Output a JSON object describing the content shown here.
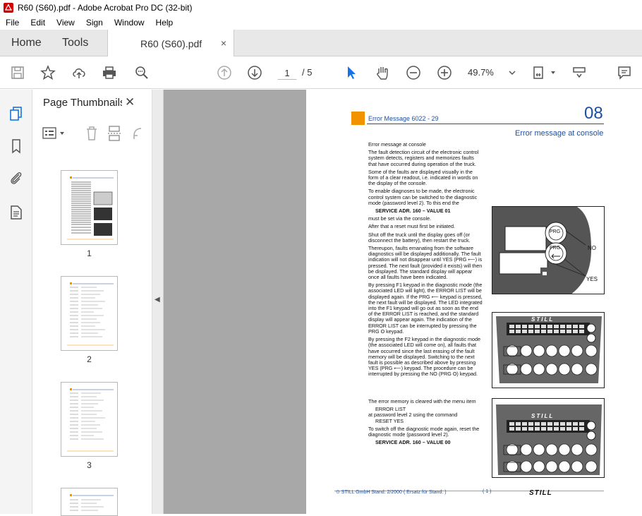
{
  "window": {
    "title": "R60 (S60).pdf - Adobe Acrobat Pro DC (32-bit)"
  },
  "menu": [
    "File",
    "Edit",
    "View",
    "Sign",
    "Window",
    "Help"
  ],
  "tabs": {
    "home": "Home",
    "tools": "Tools",
    "document": "R60 (S60).pdf",
    "close": "×"
  },
  "toolbar": {
    "page_current": "1",
    "page_sep": "/ 5",
    "zoom": "49.7%"
  },
  "panel": {
    "title": "Page Thumbnails",
    "close": "✕",
    "thumbnails": [
      "1",
      "2",
      "3"
    ]
  },
  "document": {
    "header_left": "Error Message  6022 - 29",
    "header_num": "08",
    "header_sub": "Error message at console",
    "p1_title": "Error message at console",
    "p1": "The fault detection circuit of the electronic control system detects, registers and memorizes faults that have occurred during operation of the truck.",
    "p2": "Some of the faults are displayed visually in the form of a clear readout, i.e. indicated in words on the display of the console.",
    "p3": "To enable diagnoses to be made, the electronic control system can be switched to the diagnostic mode (password level 2). To this end the",
    "p3_cmd": "SERVICE ADR. 160 – VALUE 01",
    "p4": "must be set via the console.",
    "p5": "After that a reset must first be initiated.",
    "p6": "Shut off the truck until the display goes off (or disconnect the battery), then restart the truck.",
    "p7": "Thereupon, faults emanating from the software diagnostics will be displayed additionally. The fault indication will not disappear until YES (PRG ⟵) is pressed. The next fault (provided it exists) will then be displayed. The standard display will appear once all faults have been indicated.",
    "p8": "By pressing F1 keypad in the diagnostic mode (the associated LED will light), the ERROR LIST will be displayed again. If the PRG ⟵ keypad is pressed, the next fault will be displayed. The LED integrated into the F1 keypad will go out as soon as the end of the ERROR LIST is reached, and the standard display will appear again. The indication of the ERROR LIST can be interrupted by pressing the PRG O keypad.",
    "p9": "By pressing the F2 keypad in the diagnostic mode (the associated LED will come on), all faults that have occurred since the last erasing of the fault memory will be displayed. Switching to the next fault is possible as described above by pressing YES (PRG ⟵) keypad. The procedure can be interrupted by pressing the NO (PRG O) keypad.",
    "p10": "The error memory is cleared with the menu item",
    "p10_cmd": "ERROR LIST",
    "p11": "at password level 2 using the command",
    "p11_cmd": "RESET     YES",
    "p12": "To switch off the diagnostic mode again, reset the diagnostic mode (password level 2).",
    "p12_cmd": "SERVICE ADR. 160 – VALUE 00",
    "fig1_prg1": "PRG",
    "fig1_prg2": "PRG",
    "fig1_no": "NO",
    "fig1_yes": "YES",
    "fig_brand": "STILL",
    "footer": "⊙ STILL GmbH   Stand:  2/2000  ( Ersatz für Stand:          )",
    "footer_page": "( 1 )",
    "footer_logo": "STILL"
  }
}
